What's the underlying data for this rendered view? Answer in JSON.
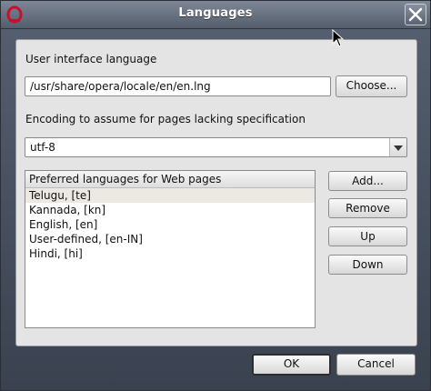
{
  "window": {
    "title": "Languages"
  },
  "ui_language": {
    "label": "User interface language",
    "path": "/usr/share/opera/locale/en/en.lng",
    "choose_label": "Choose..."
  },
  "encoding": {
    "label": "Encoding to assume for pages lacking specification",
    "value": "utf-8"
  },
  "preferred": {
    "header": "Preferred languages for Web pages",
    "items": [
      {
        "label": "Telugu, [te]",
        "selected": true
      },
      {
        "label": "Kannada, [kn]",
        "selected": false
      },
      {
        "label": "English, [en]",
        "selected": false
      },
      {
        "label": "User-defined, [en-IN]",
        "selected": false
      },
      {
        "label": "Hindi, [hi]",
        "selected": false
      }
    ],
    "add_label": "Add...",
    "remove_label": "Remove",
    "up_label": "Up",
    "down_label": "Down"
  },
  "footer": {
    "ok_label": "OK",
    "cancel_label": "Cancel"
  },
  "colors": {
    "title_bar": "#6b7482",
    "accent_icon": "#c8102e"
  },
  "icons": {
    "app": "opera-logo-icon",
    "close": "close-icon",
    "dropdown": "chevron-down-icon"
  }
}
